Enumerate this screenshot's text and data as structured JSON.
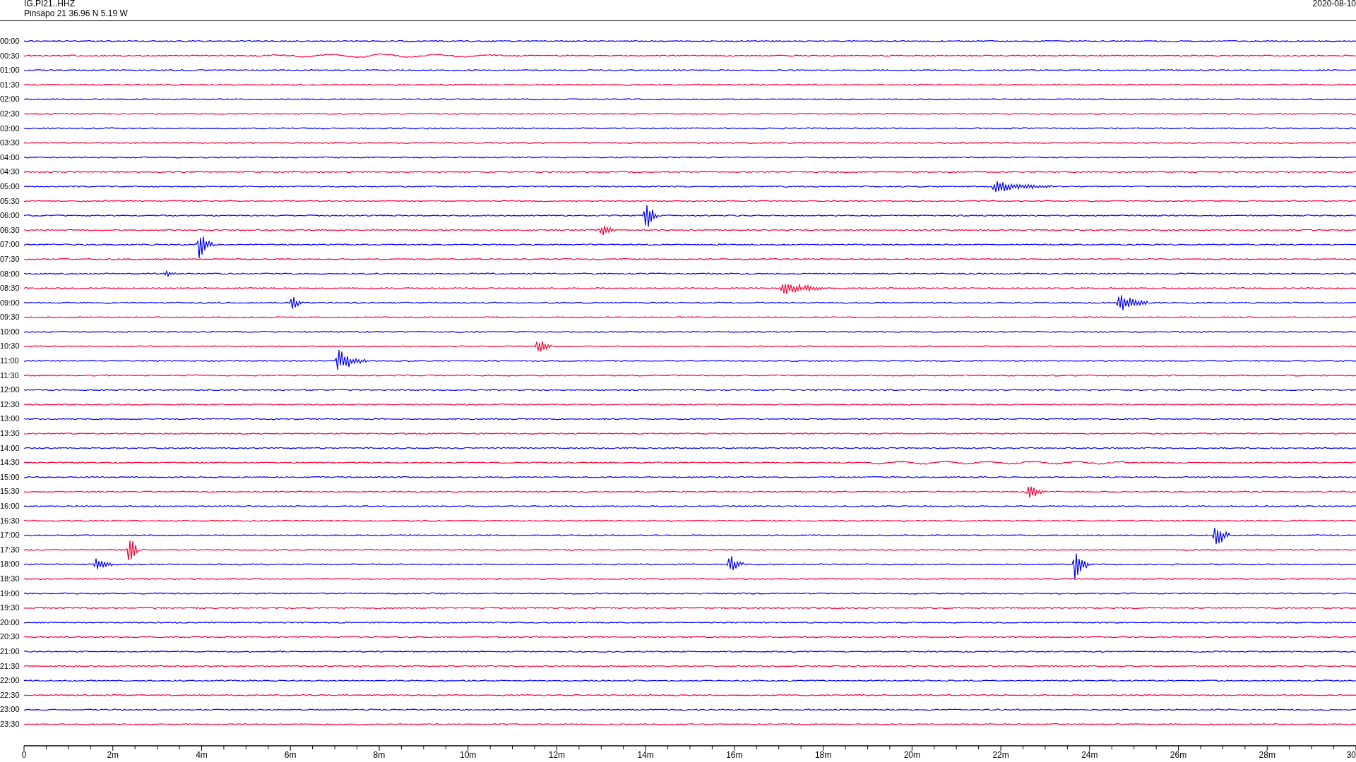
{
  "header": {
    "station_code": "IG.PI21..HHZ",
    "station_info": "Pinsapo 21  36.96 N 5.19 W",
    "date": "2020-08-10"
  },
  "rows": [
    {
      "time": "00:00",
      "color": "#0000ff"
    },
    {
      "time": "00:30",
      "color": "#ff0033"
    },
    {
      "time": "01:00",
      "color": "#0000ff"
    },
    {
      "time": "01:30",
      "color": "#ff0033"
    },
    {
      "time": "02:00",
      "color": "#0000ff"
    },
    {
      "time": "02:30",
      "color": "#ff0033"
    },
    {
      "time": "03:00",
      "color": "#0000ff"
    },
    {
      "time": "03:30",
      "color": "#ff0033"
    },
    {
      "time": "04:00",
      "color": "#0000ff"
    },
    {
      "time": "04:30",
      "color": "#ff0033"
    },
    {
      "time": "05:00",
      "color": "#0000ff"
    },
    {
      "time": "05:30",
      "color": "#ff0033"
    },
    {
      "time": "06:00",
      "color": "#0000ff"
    },
    {
      "time": "06:30",
      "color": "#ff0033"
    },
    {
      "time": "07:00",
      "color": "#0000ff"
    },
    {
      "time": "07:30",
      "color": "#ff0033"
    },
    {
      "time": "08:00",
      "color": "#0000ff"
    },
    {
      "time": "08:30",
      "color": "#ff0033"
    },
    {
      "time": "09:00",
      "color": "#0000ff"
    },
    {
      "time": "09:30",
      "color": "#ff0033"
    },
    {
      "time": "10:00",
      "color": "#0000ff"
    },
    {
      "time": "10:30",
      "color": "#ff0033"
    },
    {
      "time": "11:00",
      "color": "#0000ff"
    },
    {
      "time": "11:30",
      "color": "#ff0033"
    },
    {
      "time": "12:00",
      "color": "#0000ff"
    },
    {
      "time": "12:30",
      "color": "#ff0033"
    },
    {
      "time": "13:00",
      "color": "#0000ff"
    },
    {
      "time": "13:30",
      "color": "#ff0033"
    },
    {
      "time": "14:00",
      "color": "#0000ff"
    },
    {
      "time": "14:30",
      "color": "#ff0033"
    },
    {
      "time": "15:00",
      "color": "#0000ff"
    },
    {
      "time": "15:30",
      "color": "#ff0033"
    },
    {
      "time": "16:00",
      "color": "#0000ff"
    },
    {
      "time": "16:30",
      "color": "#ff0033"
    },
    {
      "time": "17:00",
      "color": "#0000ff"
    },
    {
      "time": "17:30",
      "color": "#ff0033"
    },
    {
      "time": "18:00",
      "color": "#0000ff"
    },
    {
      "time": "18:30",
      "color": "#ff0033"
    },
    {
      "time": "19:00",
      "color": "#0000ff"
    },
    {
      "time": "19:30",
      "color": "#ff0033"
    },
    {
      "time": "20:00",
      "color": "#0000ff"
    },
    {
      "time": "20:30",
      "color": "#ff0033"
    },
    {
      "time": "21:00",
      "color": "#0000ff"
    },
    {
      "time": "21:30",
      "color": "#ff0033"
    },
    {
      "time": "22:00",
      "color": "#0000ff"
    },
    {
      "time": "22:30",
      "color": "#ff0033"
    },
    {
      "time": "23:00",
      "color": "#0000ff"
    },
    {
      "time": "23:30",
      "color": "#ff0033"
    }
  ],
  "x_axis": {
    "tick_labels": [
      "0",
      "2m",
      "4m",
      "6m",
      "8m",
      "10m",
      "12m",
      "14m",
      "16m",
      "18m",
      "20m",
      "22m",
      "24m",
      "26m",
      "28m",
      "30"
    ]
  }
}
